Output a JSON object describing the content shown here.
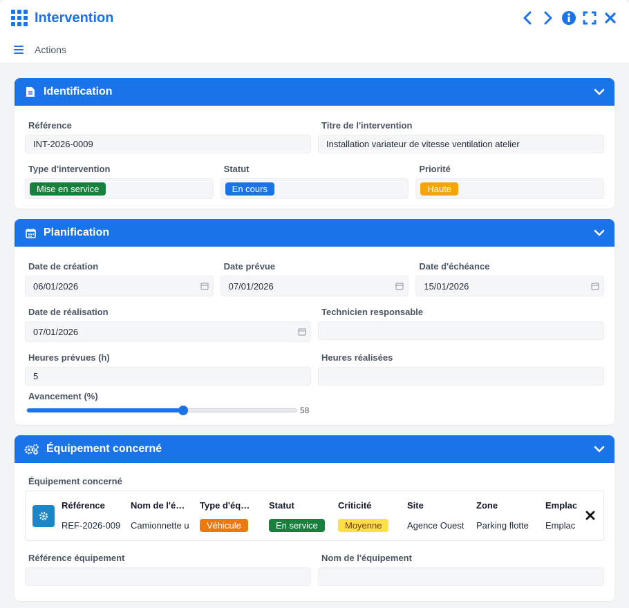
{
  "window": {
    "title": "Intervention"
  },
  "toolbar": {
    "actions_label": "Actions"
  },
  "colors": {
    "accent": "#1a73e8",
    "green": "#16803c",
    "orange": "#ea7a10",
    "amber": "#f5a50a",
    "yellow": "#fde047"
  },
  "identification": {
    "title": "Identification",
    "reference_label": "Référence",
    "reference_value": "INT-2026-0009",
    "title_label": "Titre de l'intervention",
    "title_value": "Installation variateur de vitesse ventilation atelier",
    "type_label": "Type d'intervention",
    "type_value": "Mise en service",
    "status_label": "Statut",
    "status_value": "En cours",
    "priority_label": "Priorité",
    "priority_value": "Haute"
  },
  "planification": {
    "title": "Planification",
    "creation_label": "Date de création",
    "creation_value": "06/01/2026",
    "planned_label": "Date prévue",
    "planned_value": "07/01/2026",
    "due_label": "Date d'échéance",
    "due_value": "15/01/2026",
    "done_label": "Date de réalisation",
    "done_value": "07/01/2026",
    "tech_label": "Technicien responsable",
    "tech_value": "",
    "hours_planned_label": "Heures prévues (h)",
    "hours_planned_value": "5",
    "hours_done_label": "Heures réalisées",
    "hours_done_value": "",
    "progress_label": "Avancement (%)",
    "progress_value": 58,
    "progress_text": "58"
  },
  "equipment": {
    "title": "Équipement concerné",
    "field_label": "Équipement concerné",
    "columns": [
      "Référence",
      "Nom de l'é…",
      "Type d'éq…",
      "Statut",
      "Criticité",
      "Site",
      "Zone",
      "Emplac"
    ],
    "row": {
      "reference": "REF-2026-009",
      "name": "Camionnette u",
      "type": "Véhicule",
      "status": "En service",
      "criticality": "Moyenne",
      "site": "Agence Ouest",
      "zone": "Parking flotte",
      "location": "Emplac"
    },
    "ref_eq_label": "Référence équipement",
    "name_eq_label": "Nom de l'équipement"
  },
  "icons": {
    "app": "grid-icon",
    "prev": "chevron-left-icon",
    "next": "chevron-right-icon",
    "info": "info-icon",
    "expand": "expand-icon",
    "close": "close-icon",
    "menu": "hamburger-icon",
    "calendar": "calendar-icon",
    "gear": "gear-icon"
  }
}
